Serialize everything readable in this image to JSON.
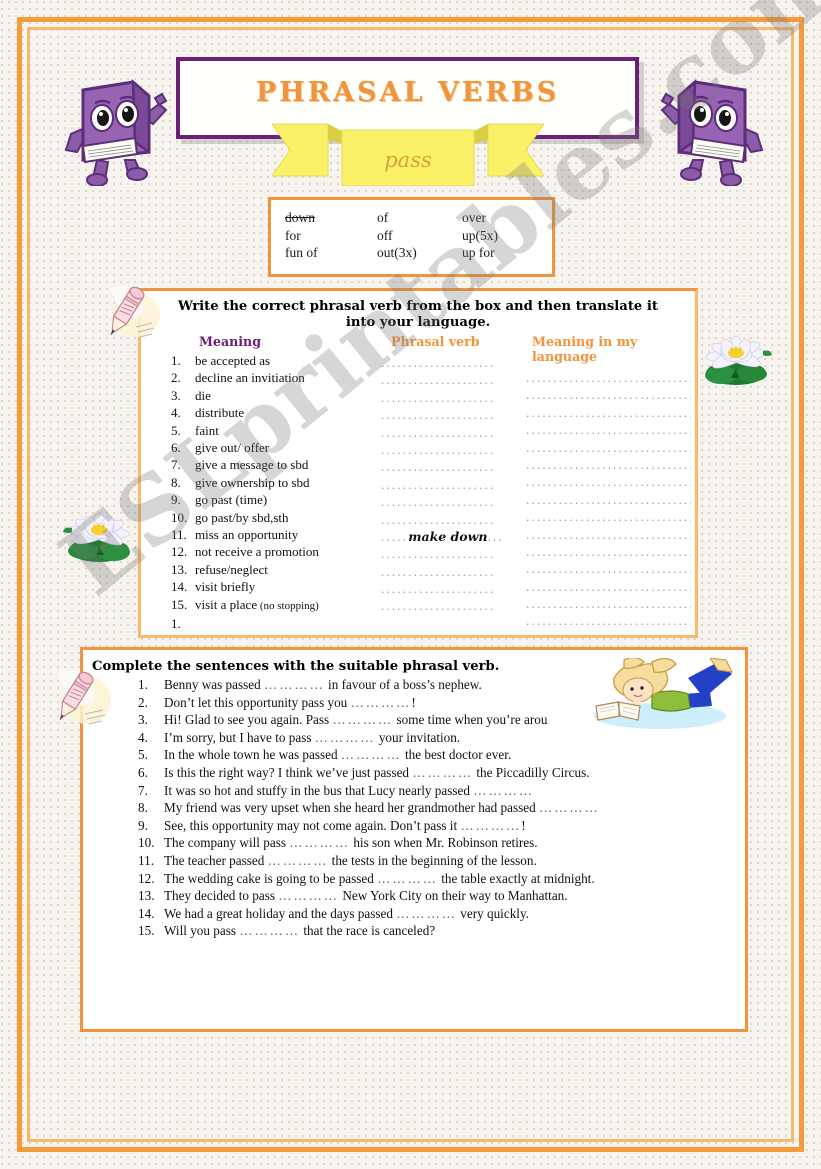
{
  "title": {
    "main": "PHRASAL  VERBS",
    "ribbon": "pass"
  },
  "word_box": {
    "words": [
      {
        "text": "down",
        "struck": true
      },
      {
        "text": "of",
        "struck": false
      },
      {
        "text": "over",
        "struck": false
      },
      {
        "text": "for",
        "struck": false
      },
      {
        "text": "off",
        "struck": false
      },
      {
        "text": "up(5x)",
        "struck": false
      },
      {
        "text": "fun of",
        "struck": false
      },
      {
        "text": "out(3x)",
        "struck": false
      },
      {
        "text": "up for",
        "struck": false
      }
    ]
  },
  "exercise1": {
    "instruction": "Write the correct phrasal verb from the box and then translate it into your language.",
    "headers": {
      "meaning": "Meaning",
      "phrasal_verb": "Phrasal verb",
      "my_language": "Meaning in my language"
    },
    "rows": [
      {
        "num": "1.",
        "meaning": "be accepted as",
        "note": "",
        "answer": ""
      },
      {
        "num": "2.",
        "meaning": "decline an invitiation",
        "note": "",
        "answer": ""
      },
      {
        "num": "3.",
        "meaning": "die",
        "note": "",
        "answer": ""
      },
      {
        "num": "4.",
        "meaning": "distribute",
        "note": "",
        "answer": ""
      },
      {
        "num": "5.",
        "meaning": "faint",
        "note": "",
        "answer": ""
      },
      {
        "num": "6.",
        "meaning": "give out/ offer",
        "note": "",
        "answer": ""
      },
      {
        "num": "7.",
        "meaning": "give a message to sbd",
        "note": "",
        "answer": ""
      },
      {
        "num": "8.",
        "meaning": "give ownership to sbd",
        "note": "",
        "answer": ""
      },
      {
        "num": "9.",
        "meaning": "go past (time)",
        "note": "",
        "answer": ""
      },
      {
        "num": "10.",
        "meaning": "go past/by sbd,sth",
        "note": "",
        "answer": ""
      },
      {
        "num": "11.",
        "meaning": "miss an opportunity",
        "note": "",
        "answer": "make down"
      },
      {
        "num": "12.",
        "meaning": "not receive a promotion",
        "note": "",
        "answer": ""
      },
      {
        "num": "13.",
        "meaning": "refuse/neglect",
        "note": "",
        "answer": ""
      },
      {
        "num": "14.",
        "meaning": "visit briefly",
        "note": "",
        "answer": ""
      },
      {
        "num": "15.",
        "meaning": "visit a place",
        "note": "(no stopping)",
        "answer": ""
      },
      {
        "num": "1.",
        "meaning": "",
        "note": "",
        "answer": ""
      }
    ],
    "dots_short": ".....................",
    "dots_long": "................................",
    "answer_prefix": ".....",
    "answer_suffix": "..."
  },
  "exercise2": {
    "instruction": "Complete the sentences with the suitable phrasal verb.",
    "sentences": [
      {
        "num": "1.",
        "before": "Benny was passed ",
        "gap": "…………",
        "after": " in favour of a boss’s nephew."
      },
      {
        "num": "2.",
        "before": "Don’t let this opportunity pass you ",
        "gap": "…………",
        "after": "!"
      },
      {
        "num": "3.",
        "before": "Hi! Glad to see you again. Pass ",
        "gap": "…………",
        "after": " some time when you’re arou"
      },
      {
        "num": "4.",
        "before": "I’m sorry, but I have to pass ",
        "gap": "…………",
        "after": " your invitation."
      },
      {
        "num": "5.",
        "before": "In the whole town he was passed ",
        "gap": "…………",
        "after": " the best doctor ever."
      },
      {
        "num": "6.",
        "before": "Is this the right way? I think we’ve just passed ",
        "gap": "…………",
        "after": " the Piccadilly Circus."
      },
      {
        "num": "7.",
        "before": "It was so hot and stuffy in the bus that Lucy nearly passed ",
        "gap": "…………",
        "after": ""
      },
      {
        "num": "8.",
        "before": "My friend was very upset when she heard her grandmother had passed ",
        "gap": "…………",
        "after": ""
      },
      {
        "num": "9.",
        "before": "See, this opportunity may not come again. Don’t pass it ",
        "gap": "…………",
        "after": "!"
      },
      {
        "num": "10.",
        "before": "The company will pass ",
        "gap": "…………",
        "after": " his son when Mr. Robinson retires."
      },
      {
        "num": "11.",
        "before": "The teacher passed ",
        "gap": "…………",
        "after": " the tests in the beginning of the lesson."
      },
      {
        "num": "12.",
        "before": "The wedding cake is going to be passed ",
        "gap": "…………",
        "after": " the table exactly at midnight."
      },
      {
        "num": "13.",
        "before": "They decided to pass ",
        "gap": "…………",
        "after": " New York City on their way to Manhattan."
      },
      {
        "num": "14.",
        "before": "We had a great holiday and the days passed ",
        "gap": "…………",
        "after": " very quickly."
      },
      {
        "num": "15.",
        "before": "Will you pass ",
        "gap": "…………",
        "after": " that the race is canceled?"
      }
    ]
  },
  "watermark": {
    "text": "ESLprintables.com"
  },
  "colors": {
    "orange": "#f0953d",
    "orange_light": "#f9b96b",
    "purple": "#6b2077",
    "yellow": "#fbf169",
    "paper": "#f7f4ef"
  },
  "clipart": {
    "book_left": "purple-book-character-icon",
    "book_right": "purple-book-character-icon",
    "pencil_top": "pencil-writing-icon",
    "pencil_bottom": "pencil-writing-icon",
    "lily_right": "water-lily-flower-icon",
    "lily_left": "water-lily-flower-icon",
    "girl": "girl-reading-book-icon"
  }
}
